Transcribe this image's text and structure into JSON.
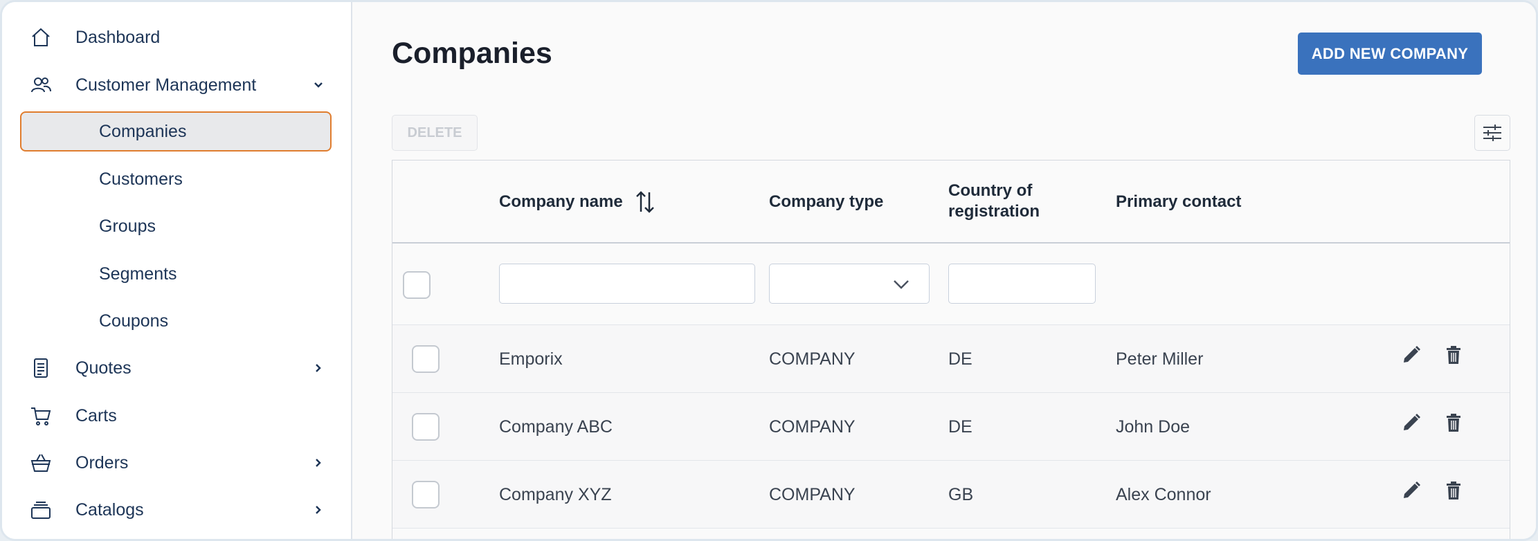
{
  "sidebar": {
    "items": [
      {
        "label": "Dashboard",
        "icon": "home-icon"
      },
      {
        "label": "Customer Management",
        "icon": "users-icon"
      },
      {
        "label": "Quotes",
        "icon": "document-icon"
      },
      {
        "label": "Carts",
        "icon": "cart-icon"
      },
      {
        "label": "Orders",
        "icon": "basket-icon"
      },
      {
        "label": "Catalogs",
        "icon": "layers-icon"
      }
    ],
    "sub_items": [
      {
        "label": "Companies",
        "active": true
      },
      {
        "label": "Customers"
      },
      {
        "label": "Groups"
      },
      {
        "label": "Segments"
      },
      {
        "label": "Coupons"
      }
    ]
  },
  "page": {
    "title": "Companies",
    "add_button": "ADD NEW COMPANY",
    "delete_button": "DELETE"
  },
  "table": {
    "columns": [
      "Company name",
      "Company type",
      "Country of registration",
      "Primary contact"
    ],
    "rows": [
      {
        "name": "Emporix",
        "type": "COMPANY",
        "country": "DE",
        "contact": "Peter Miller"
      },
      {
        "name": "Company ABC",
        "type": "COMPANY",
        "country": "DE",
        "contact": "John Doe"
      },
      {
        "name": "Company XYZ",
        "type": "COMPANY",
        "country": "GB",
        "contact": "Alex Connor"
      }
    ]
  },
  "colors": {
    "accent": "#3a72bd",
    "active_border": "#e07d2e"
  }
}
